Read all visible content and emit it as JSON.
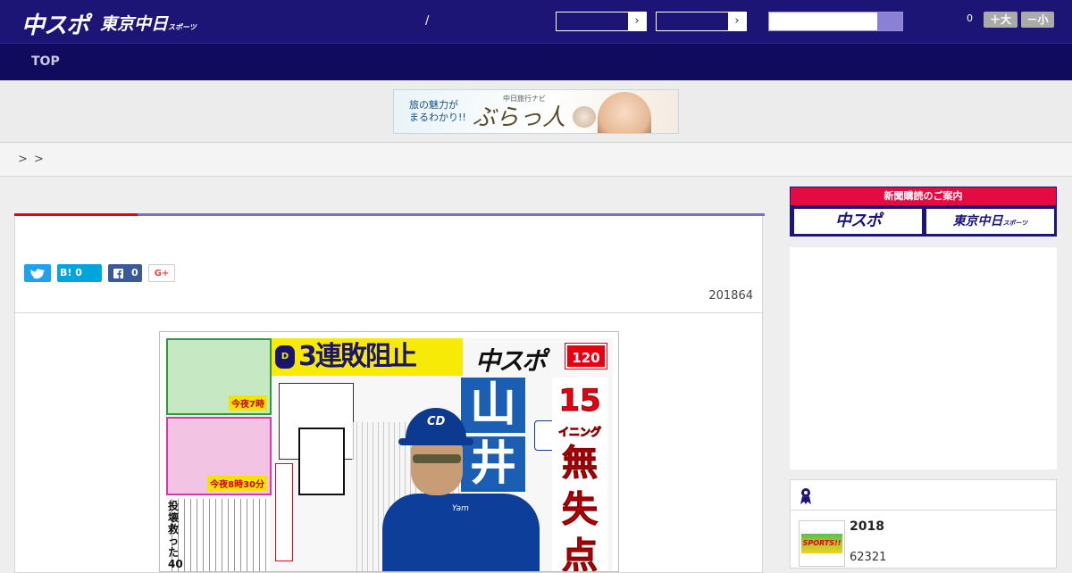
{
  "header": {
    "logo_main": "中スポ",
    "logo_tokyo": "東京中日",
    "logo_tokyo_suffix": "スポーツ",
    "separator": "/",
    "counter": "0",
    "font_larger_label": "＋大",
    "font_smaller_label": "－小",
    "chevron": "›"
  },
  "nav": {
    "top_label": "TOP"
  },
  "banner": {
    "line1": "旅の魅力が",
    "line2": "まるわかり!!",
    "small": "中日旅行ナビ",
    "logo": "ぶらっ人"
  },
  "breadcrumb": {
    "sep1": ">",
    "sep2": ">"
  },
  "article": {
    "share": {
      "twitter_label": "",
      "hatena_label": "B!",
      "hatena_count": "0",
      "facebook_count": "0",
      "gplus_label": "G+"
    },
    "date": "201864"
  },
  "newspaper": {
    "headline": "3連敗阻止",
    "dragons_mark": "D",
    "logo": "中スポ",
    "price": "120円",
    "player_name": [
      "山",
      "井"
    ],
    "side_headline": [
      "15",
      "イニング",
      "無",
      "失",
      "点"
    ],
    "cap_logo": "CD",
    "uniform_text": "Yam",
    "ad1_time": "今夜7時",
    "ad2_time": "今夜8時30分",
    "vertical_text": "投壊救った40"
  },
  "sidebar": {
    "subscription_header": "新聞購読のご案内",
    "subscribe_chuspo": "中スポ",
    "subscribe_tokyo": "東京中日",
    "subscribe_tokyo_suffix": "スポーツ",
    "ranking": {
      "item_year": "2018",
      "item_number": "62321",
      "thumb_label": "SPORTS!!"
    }
  },
  "colors": {
    "brand_navy": "#1c1576",
    "nav_dark": "#110b5e",
    "accent_red": "#e60012",
    "accent_blue": "#7a70c2",
    "subscription_pink": "#e50a41"
  },
  "icons": {
    "twitter": "twitter-icon",
    "facebook": "facebook-icon",
    "ranking": "ribbon-icon"
  }
}
